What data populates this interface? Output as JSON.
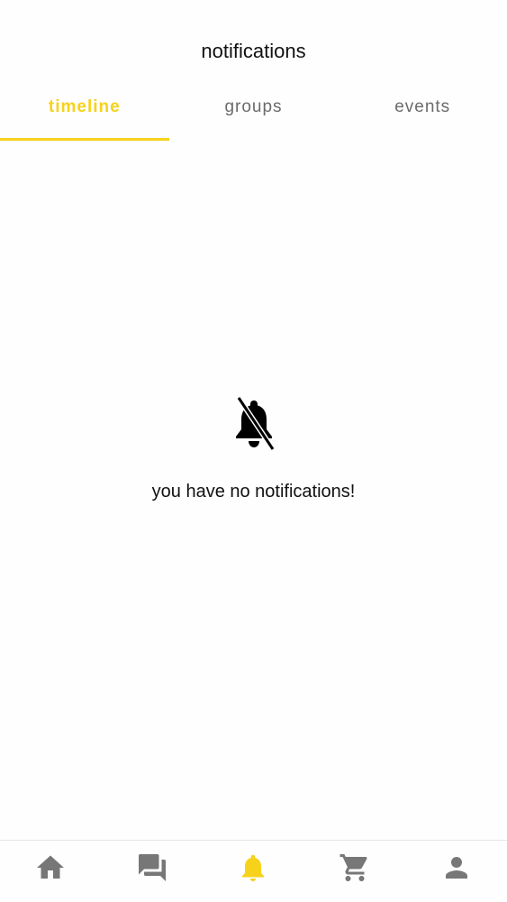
{
  "header": {
    "title": "notifications"
  },
  "tabs": [
    {
      "label": "timeline",
      "active": true
    },
    {
      "label": "groups",
      "active": false
    },
    {
      "label": "events",
      "active": false
    }
  ],
  "empty_state": {
    "icon": "bell-off-icon",
    "message": "you have no notifications!"
  },
  "bottom_nav": [
    {
      "icon": "home-icon",
      "active": false
    },
    {
      "icon": "chat-icon",
      "active": false
    },
    {
      "icon": "bell-icon",
      "active": true
    },
    {
      "icon": "cart-icon",
      "active": false
    },
    {
      "icon": "profile-icon",
      "active": false
    }
  ],
  "colors": {
    "accent": "#f7d21a",
    "inactive": "#6b6b6b",
    "icon_inactive": "#777777"
  }
}
